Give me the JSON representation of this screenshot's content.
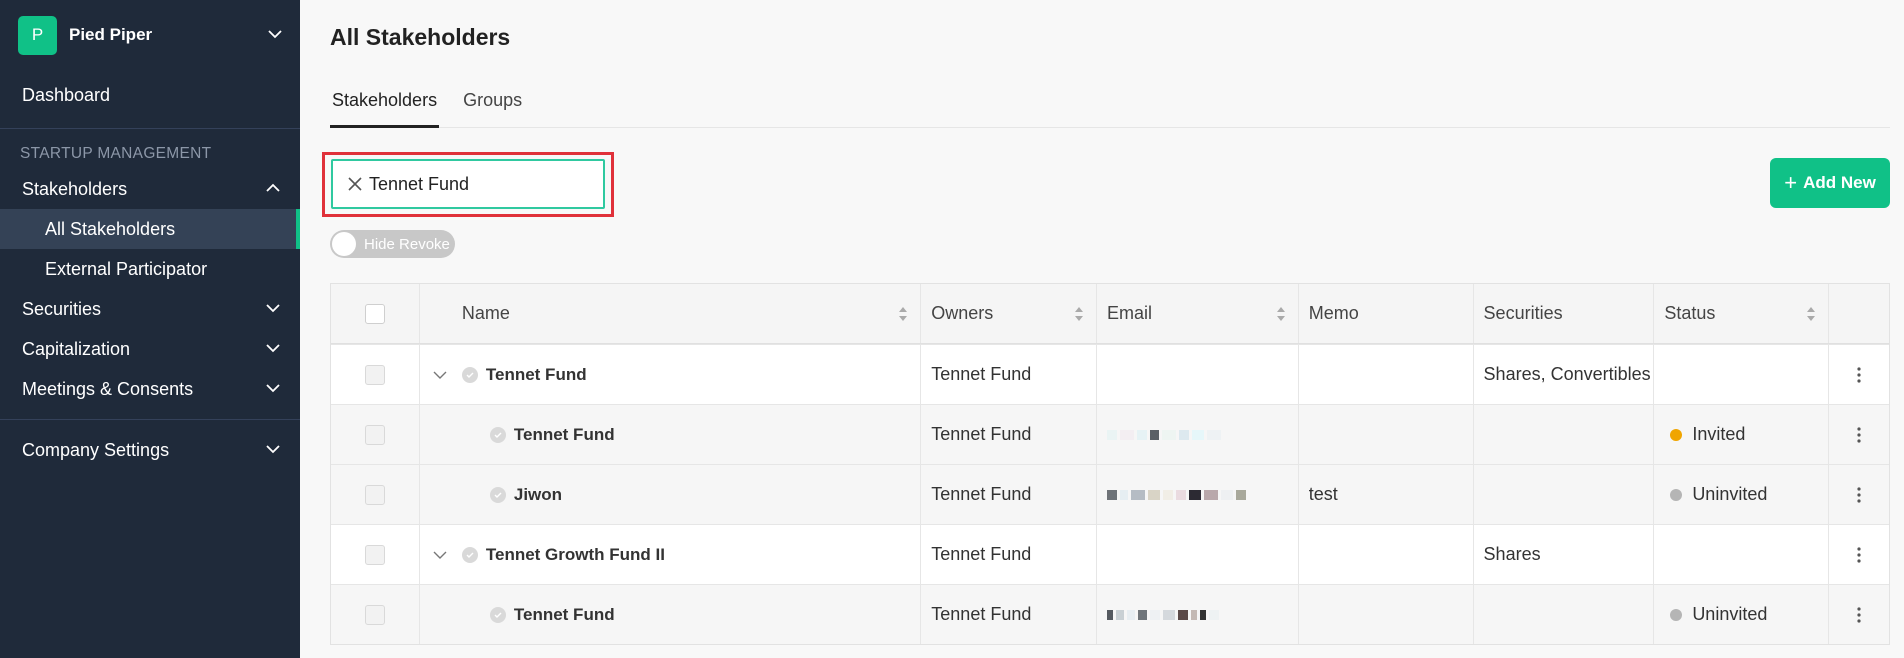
{
  "org": {
    "logo_letter": "P",
    "name": "Pied Piper"
  },
  "sidebar": {
    "dashboard": "Dashboard",
    "section_title": "STARTUP MANAGEMENT",
    "stakeholders": "Stakeholders",
    "all_stakeholders": "All Stakeholders",
    "external_participator": "External Participator",
    "securities": "Securities",
    "capitalization": "Capitalization",
    "meetings": "Meetings & Consents",
    "company_settings": "Company Settings"
  },
  "page": {
    "title": "All Stakeholders"
  },
  "tabs": {
    "stakeholders": "Stakeholders",
    "groups": "Groups"
  },
  "search": {
    "value": "Tennet Fund"
  },
  "add_button": "Add New",
  "toggle_label": "Hide Revoke",
  "table": {
    "headers": {
      "name": "Name",
      "owners": "Owners",
      "email": "Email",
      "memo": "Memo",
      "securities": "Securities",
      "status": "Status"
    },
    "rows": [
      {
        "name": "Tennet Fund",
        "owners": "Tennet Fund",
        "memo": "",
        "securities": "Shares, Convertibles",
        "status": ""
      },
      {
        "name": "Tennet Fund",
        "owners": "Tennet Fund",
        "memo": "",
        "securities": "",
        "status": "Invited"
      },
      {
        "name": "Jiwon",
        "owners": "Tennet Fund",
        "memo": "test",
        "securities": "",
        "status": "Uninvited"
      },
      {
        "name": "Tennet Growth Fund II",
        "owners": "Tennet Fund",
        "memo": "",
        "securities": "Shares",
        "status": ""
      },
      {
        "name": "Tennet Fund",
        "owners": "Tennet Fund",
        "memo": "",
        "securities": "",
        "status": "Uninvited"
      }
    ]
  },
  "colors": {
    "accent": "#10c187",
    "sidebar_bg": "#1f2a3a",
    "invited": "#f0a500",
    "uninvited": "#b5b5b5",
    "highlight": "#e0313a"
  }
}
